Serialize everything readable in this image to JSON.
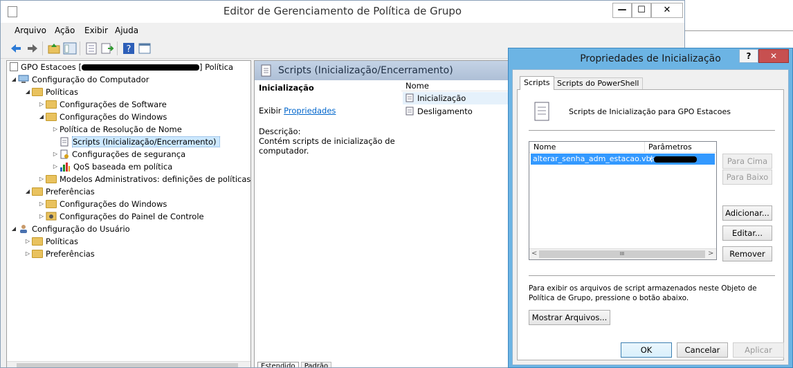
{
  "main_window": {
    "title": "Editor de Gerenciamento de Política de Grupo",
    "minimize": "—",
    "maximize": "☐",
    "close": "✕"
  },
  "menu": [
    "Arquivo",
    "Ação",
    "Exibir",
    "Ajuda"
  ],
  "toolbar": {
    "icons": [
      "back-arrow-icon",
      "forward-arrow-icon",
      "up-folder-icon",
      "show-tree-icon",
      "properties-icon",
      "export-list-icon",
      "help-icon",
      "console-icon"
    ]
  },
  "tree": {
    "root": "GPO Estacoes [",
    "root_suffix": "] Política",
    "items": [
      {
        "label": "Configuração do Computador",
        "level": 1,
        "expanded": true,
        "icon": "computer-icon"
      },
      {
        "label": "Políticas",
        "level": 2,
        "expanded": true,
        "icon": "folder-icon"
      },
      {
        "label": "Configurações de Software",
        "level": 3,
        "expanded": false,
        "icon": "folder-icon"
      },
      {
        "label": "Configurações do Windows",
        "level": 3,
        "expanded": true,
        "icon": "folder-icon"
      },
      {
        "label": "Política de Resolução de Nome",
        "level": 4,
        "expanded": false,
        "icon": "none"
      },
      {
        "label": "Scripts (Inicialização/Encerramento)",
        "level": 4,
        "expanded": null,
        "icon": "script-icon",
        "selected": true
      },
      {
        "label": "Configurações de segurança",
        "level": 4,
        "expanded": false,
        "icon": "security-icon"
      },
      {
        "label": "QoS baseada em política",
        "level": 4,
        "expanded": false,
        "icon": "chart-icon"
      },
      {
        "label": "Modelos Administrativos: definições de políticas (a",
        "level": 3,
        "expanded": false,
        "icon": "folder-icon"
      },
      {
        "label": "Preferências",
        "level": 2,
        "expanded": true,
        "icon": "folder-icon"
      },
      {
        "label": "Configurações do Windows",
        "level": 3,
        "expanded": false,
        "icon": "folder-icon"
      },
      {
        "label": "Configurações do Painel de Controle",
        "level": 3,
        "expanded": false,
        "icon": "control-panel-icon"
      },
      {
        "label": "Configuração do Usuário",
        "level": 1,
        "expanded": true,
        "icon": "user-icon"
      },
      {
        "label": "Políticas",
        "level": 2,
        "expanded": false,
        "icon": "folder-icon"
      },
      {
        "label": "Preferências",
        "level": 2,
        "expanded": false,
        "icon": "folder-icon"
      }
    ]
  },
  "details": {
    "header": "Scripts (Inicialização/Encerramento)",
    "section_title": "Inicialização",
    "show_prefix": "Exibir",
    "show_link": "Propriedades",
    "description_label": "Descrição:",
    "description_text": "Contém scripts de inicialização de computador.",
    "list_header": "Nome",
    "list_items": [
      "Inicialização",
      "Desligamento"
    ],
    "tabs": [
      "Estendido",
      "Padrão"
    ]
  },
  "dialog": {
    "title": "Propriedades de Inicialização",
    "help": "?",
    "close": "✕",
    "tabs": [
      "Scripts",
      "Scripts do PowerShell"
    ],
    "header_text": "Scripts de Inicialização para GPO Estacoes",
    "columns": [
      "Nome",
      "Parâmetros"
    ],
    "rows": [
      {
        "name": "alterar_senha_adm_estacao.vbs",
        "params": "("
      }
    ],
    "side_buttons": {
      "up": "Para Cima",
      "down": "Para Baixo",
      "add": "Adicionar...",
      "edit": "Editar...",
      "remove": "Remover"
    },
    "info_text": "Para exibir os arquivos de script armazenados neste Objeto de Política de Grupo, pressione o botão abaixo.",
    "show_files": "Mostrar Arquivos...",
    "ok": "OK",
    "cancel": "Cancelar",
    "apply": "Aplicar",
    "scroll_glyph": "III",
    "scroll_left": "<",
    "scroll_right": ">"
  },
  "colors": {
    "accent": "#6cb4e4",
    "selection": "#3399ff",
    "link": "#0066cc"
  }
}
